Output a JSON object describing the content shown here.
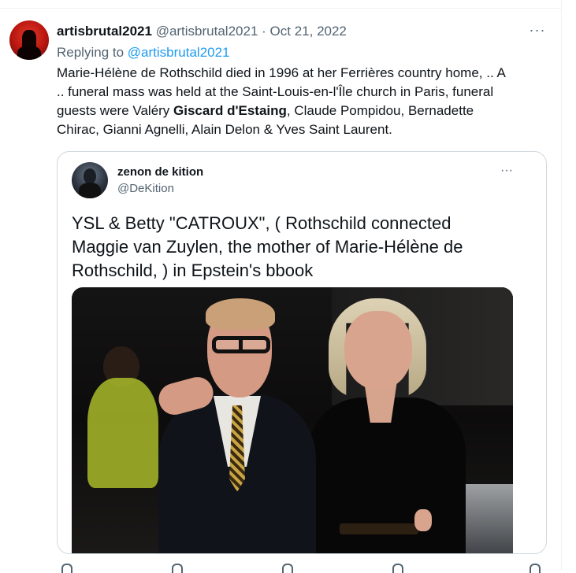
{
  "tweet": {
    "author_name": "artisbrutal2021",
    "author_handle": "@artisbrutal2021",
    "separator": "·",
    "date": "Oct 21, 2022",
    "more_icon": "···",
    "replying_prefix": "Replying to",
    "replying_handle": "@artisbrutal2021",
    "text": {
      "line1": "Marie-Hélène de Rothschild died in 1996 at her Ferrières country home, .. A",
      "line2": ".. funeral mass was held at the Saint-Louis-en-l'Île church in Paris, funeral",
      "line3_before": "guests were Valéry ",
      "line3_bold": "Giscard d'Estaing",
      "line3_after": ", Claude Pompidou, Bernadette",
      "line4": "Chirac, Gianni Agnelli, Alain Delon & Yves Saint Laurent."
    }
  },
  "quote": {
    "author_name": "zenon de kition",
    "author_handle": "@DeKition",
    "more_icon": "···",
    "text": {
      "line1": "YSL & Betty \"CATROUX\", ( Rothschild connected",
      "line2": "Maggie van Zuylen, the mother of Marie-Hélène de",
      "line3": "Rothschild, ) in Epstein's bbook"
    }
  },
  "colors": {
    "link": "#1d9bf0",
    "secondary_text": "#536471",
    "border": "#cfd9de"
  }
}
